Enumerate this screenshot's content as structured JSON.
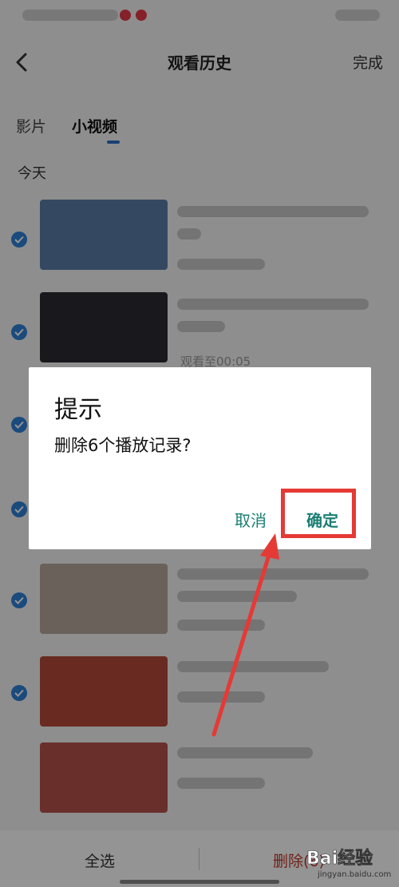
{
  "nav": {
    "title": "观看历史",
    "done_label": "完成",
    "back_icon": "chevron-left-icon"
  },
  "tabs": [
    {
      "label": "影片",
      "active": false
    },
    {
      "label": "小视频",
      "active": true
    }
  ],
  "section_title": "今天",
  "list_items": [
    {
      "checked": true,
      "thumb_color": "#5a7fa8",
      "progress_text": ""
    },
    {
      "checked": true,
      "thumb_color": "#2b2b33",
      "progress_text": "观看至00:05"
    },
    {
      "checked": true,
      "thumb_color": "#c7b49a",
      "progress_text": ""
    },
    {
      "checked": true,
      "thumb_color": "#a98e6a",
      "progress_text": ""
    },
    {
      "checked": true,
      "thumb_color": "#b6a89c",
      "progress_text": ""
    },
    {
      "checked": true,
      "thumb_color": "#b54a3a",
      "progress_text": ""
    }
  ],
  "bottom_bar": {
    "select_all_label": "全选",
    "delete_label": "删除(6)"
  },
  "dialog": {
    "title": "提示",
    "message": "删除6个播放记录?",
    "cancel_label": "取消",
    "confirm_label": "确定"
  },
  "watermark": {
    "text": "Bai经验",
    "url": "jingyan.baidu.com"
  },
  "colors": {
    "accent_blue": "#2f80d8",
    "dialog_button": "#1a7f73",
    "annotation_red": "#e53935",
    "delete_red": "#c0392b"
  }
}
